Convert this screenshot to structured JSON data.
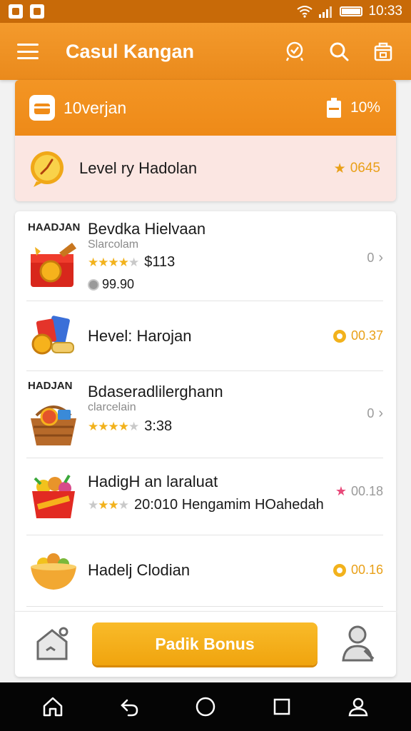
{
  "status_bar": {
    "time": "10:33"
  },
  "app_bar": {
    "title": "Casul Kangan"
  },
  "top_card": {
    "title": "10verjan",
    "percent": "10%",
    "level_label": "Level ry Hadolan",
    "level_points": "0645"
  },
  "list": [
    {
      "tag": "HAADJAN",
      "title": "Bevdka Hielvaan",
      "subtitle": "Slarcolam",
      "meta": "$113",
      "price": "99.90",
      "right": "0",
      "stars": 4
    },
    {
      "tag": "",
      "title": "Hevel: Harojan",
      "subtitle": "",
      "meta": "",
      "price": "",
      "right": "00.37",
      "stars": 0
    },
    {
      "tag": "HADJAN",
      "title": "Bdaseradlilerghann",
      "subtitle": "clarcelain",
      "meta": "3:38",
      "price": "",
      "right": "0",
      "stars": 4
    },
    {
      "tag": "",
      "title": "HadigH an laraluat",
      "subtitle": "",
      "meta": "20:010 Hengamim HOahedah",
      "price": "",
      "right": "00.18",
      "stars": 3
    },
    {
      "tag": "",
      "title": "Hadelj Clodian",
      "subtitle": "",
      "meta": "",
      "price": "",
      "right": "00.16",
      "stars": 0
    }
  ],
  "bottom": {
    "bonus_label": "Padik Bonus"
  },
  "colors": {
    "primary": "#f0901e",
    "accent": "#f5b01c",
    "level_bg": "#fbe6e2",
    "status_bar": "#c86a08"
  }
}
